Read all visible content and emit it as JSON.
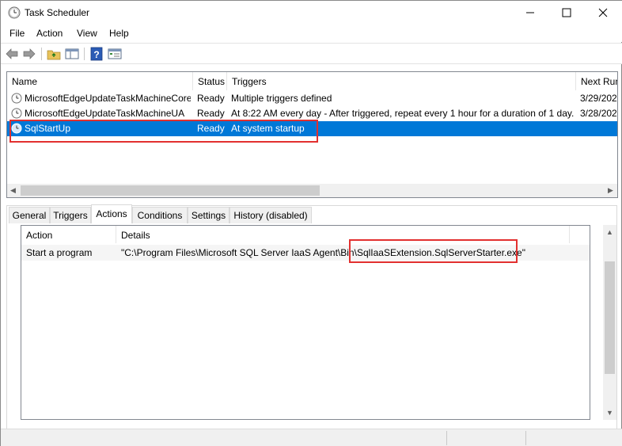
{
  "window": {
    "title": "Task Scheduler",
    "icon": "clock-icon",
    "controls": [
      "minimize-icon",
      "maximize-icon",
      "close-icon"
    ]
  },
  "menu": {
    "items": [
      "File",
      "Action",
      "View",
      "Help"
    ]
  },
  "toolbar": {
    "buttons": [
      "back-arrow-icon",
      "forward-arrow-icon",
      "up-folder-icon",
      "show-hide-pane-icon",
      "help-icon",
      "properties-icon"
    ]
  },
  "task_list": {
    "columns": [
      "Name",
      "Status",
      "Triggers",
      "Next Run"
    ],
    "rows": [
      {
        "name": "MicrosoftEdgeUpdateTaskMachineCore",
        "status": "Ready",
        "triggers": "Multiple triggers defined",
        "next_run": "3/29/202",
        "selected": false
      },
      {
        "name": "MicrosoftEdgeUpdateTaskMachineUA",
        "status": "Ready",
        "triggers": "At 8:22 AM every day - After triggered, repeat every 1 hour for a duration of 1 day.",
        "next_run": "3/28/202",
        "selected": false
      },
      {
        "name": "SqlStartUp",
        "status": "Ready",
        "triggers": "At system startup",
        "next_run": "",
        "selected": true
      }
    ]
  },
  "tabs": {
    "items": [
      "General",
      "Triggers",
      "Actions",
      "Conditions",
      "Settings",
      "History (disabled)"
    ],
    "active": "Actions"
  },
  "actions": {
    "columns": [
      "Action",
      "Details"
    ],
    "rows": [
      {
        "action": "Start a program",
        "details_prefix": "\"C:\\Program Files\\Microsoft SQL Server IaaS Agent\\Bin\\",
        "details_highlight": "SqlIaaSExtension.SqlServerStarter.exe\""
      }
    ]
  },
  "colors": {
    "selection": "#0078d7",
    "highlight_border": "#e2302f"
  }
}
